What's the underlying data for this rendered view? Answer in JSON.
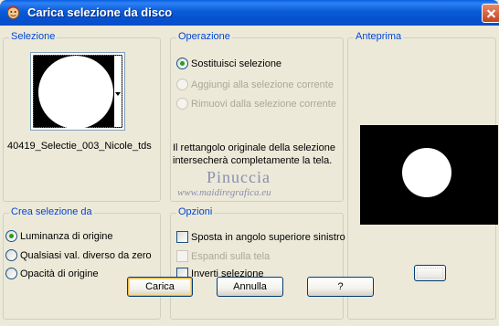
{
  "window": {
    "title": "Carica selezione da disco"
  },
  "selezione": {
    "legend": "Selezione",
    "filename": "40419_Selectie_003_Nicole_tds"
  },
  "operazione": {
    "legend": "Operazione",
    "options": [
      {
        "label": "Sostituisci selezione",
        "selected": true,
        "enabled": true
      },
      {
        "label": "Aggiungi alla selezione corrente",
        "selected": false,
        "enabled": false
      },
      {
        "label": "Rimuovi dalla selezione corrente",
        "selected": false,
        "enabled": false
      }
    ],
    "info": "Il rettangolo originale della selezione intersecherà completamente la tela."
  },
  "watermark": {
    "name": "Pinuccia",
    "url": "www.maidiregrafica.eu"
  },
  "anteprima": {
    "legend": "Anteprima"
  },
  "crea": {
    "legend": "Crea selezione da",
    "options": [
      {
        "label": "Luminanza di origine",
        "selected": true
      },
      {
        "label": "Qualsiasi val. diverso da zero",
        "selected": false
      },
      {
        "label": "Opacità di origine",
        "selected": false
      }
    ]
  },
  "opzioni": {
    "legend": "Opzioni",
    "items": [
      {
        "label": "Sposta in angolo superiore sinistro",
        "checked": false,
        "enabled": true
      },
      {
        "label": "Espandi sulla tela",
        "checked": false,
        "enabled": false
      },
      {
        "label": "Inverti selezione",
        "checked": false,
        "enabled": true
      }
    ]
  },
  "buttons": {
    "load": "Carica",
    "cancel": "Annulla",
    "help": "?"
  },
  "colors": {
    "accent": "#0046d5",
    "titlebar": "#0a5ad6",
    "radio_selected": "#21a121"
  }
}
